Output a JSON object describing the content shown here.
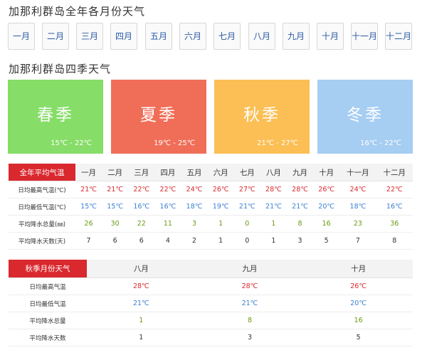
{
  "monthly_title": "加那利群岛全年各月份天气",
  "months": [
    "一月",
    "二月",
    "三月",
    "四月",
    "五月",
    "六月",
    "七月",
    "八月",
    "九月",
    "十月",
    "十一月",
    "十二月"
  ],
  "season_title": "加那利群岛四季天气",
  "seasons": [
    {
      "name": "春季",
      "range": "15℃ - 22℃",
      "color": "#86dd68"
    },
    {
      "name": "夏季",
      "range": "19℃ - 25℃",
      "color": "#f06e58"
    },
    {
      "name": "秋季",
      "range": "21℃ - 27℃",
      "color": "#fbbf55"
    },
    {
      "name": "冬季",
      "range": "16℃ - 22℃",
      "color": "#a6cdf2"
    }
  ],
  "annual": {
    "label": "全年平均气温",
    "columns": [
      "一月",
      "二月",
      "三月",
      "四月",
      "五月",
      "六月",
      "七月",
      "八月",
      "九月",
      "十月",
      "十一月",
      "十二月"
    ],
    "rows": [
      {
        "label": "日均最高气温(℃)",
        "values": [
          "21℃",
          "21℃",
          "22℃",
          "22℃",
          "24℃",
          "26℃",
          "27℃",
          "28℃",
          "28℃",
          "26℃",
          "24℃",
          "22℃"
        ]
      },
      {
        "label": "日均最低气温(℃)",
        "values": [
          "15℃",
          "15℃",
          "16℃",
          "16℃",
          "18℃",
          "19℃",
          "21℃",
          "21℃",
          "21℃",
          "20℃",
          "18℃",
          "16℃"
        ]
      },
      {
        "label": "平均降水总量(㎜)",
        "values": [
          "26",
          "30",
          "22",
          "11",
          "3",
          "1",
          "0",
          "1",
          "8",
          "16",
          "23",
          "36"
        ]
      },
      {
        "label": "平均降水天数(天)",
        "values": [
          "7",
          "6",
          "6",
          "4",
          "2",
          "1",
          "0",
          "1",
          "3",
          "5",
          "7",
          "8"
        ]
      }
    ]
  },
  "autumn": {
    "label": "秋季月份天气",
    "columns": [
      "八月",
      "九月",
      "十月"
    ],
    "rows": [
      {
        "label": "日均最高气温",
        "values": [
          "28℃",
          "28℃",
          "26℃"
        ]
      },
      {
        "label": "日均最低气温",
        "values": [
          "21℃",
          "21℃",
          "20℃"
        ]
      },
      {
        "label": "平均降水总量",
        "values": [
          "1",
          "8",
          "16"
        ]
      },
      {
        "label": "平均降水天数",
        "values": [
          "1",
          "3",
          "5"
        ]
      }
    ]
  },
  "colors": {
    "accent_red": "#d9282e",
    "high_temp": "#d9282e",
    "low_temp": "#3a7fd5",
    "rain": "#6a9a14"
  }
}
